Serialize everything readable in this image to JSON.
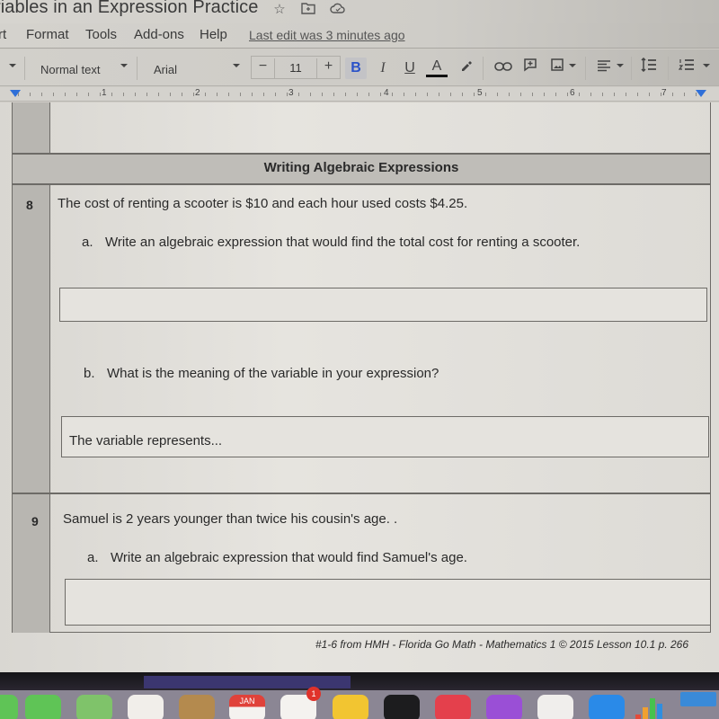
{
  "app": {
    "doc_title": "riables in an Expression Practice",
    "title_icons": [
      "star-icon",
      "move-to-folder-icon",
      "cloud-status-icon"
    ]
  },
  "menu": {
    "items": [
      "rt",
      "Format",
      "Tools",
      "Add-ons",
      "Help"
    ],
    "last_edit": "Last edit was 3 minutes ago"
  },
  "toolbar": {
    "style_select": "Normal text",
    "font_select": "Arial",
    "font_size": "11",
    "minus_label": "−",
    "plus_label": "+",
    "bold_label": "B",
    "italic_label": "I",
    "underline_label": "U",
    "text_color_label": "A",
    "icons": [
      "highlight-icon",
      "link-icon",
      "comment-icon",
      "image-icon",
      "align-icon",
      "line-spacing-icon",
      "numbered-list-icon"
    ]
  },
  "ruler": {
    "numbers": [
      "1",
      "2",
      "3",
      "4",
      "5",
      "6",
      "7"
    ]
  },
  "document": {
    "section_title": "Writing Algebraic Expressions",
    "questions": [
      {
        "number": "8",
        "text": "The cost of renting a scooter is $10 and each hour used costs $4.25.",
        "parts": [
          {
            "label": "a.",
            "text": "Write an algebraic expression that would find the total cost for renting a scooter.",
            "answer": ""
          },
          {
            "label": "b.",
            "text": "What is the meaning of the variable in your expression?",
            "answer": "The variable represents..."
          }
        ]
      },
      {
        "number": "9",
        "text": "Samuel is 2 years younger than twice his cousin's age. .",
        "parts": [
          {
            "label": "a.",
            "text": "Write an algebraic expression that would find Samuel's age.",
            "answer": ""
          }
        ]
      }
    ],
    "footer_note": "#1-6 from HMH - Florida Go Math - Mathematics 1 © 2015  Lesson 10.1 p. 266"
  },
  "dock": {
    "calendar_month": "JAN",
    "reminders_badge": "1",
    "colors": {
      "messages": "#5fc456",
      "maps": "#7fc36a",
      "photos": "#f1eeea",
      "contacts": "#b48a4e",
      "calendar": "#f4f2ef",
      "reminders": "#f4f2ef",
      "notes": "#f2c531",
      "tv": "#1c1c1e",
      "music": "#e4404c",
      "podcasts": "#9a4fd6",
      "news": "#f0eeec",
      "appstore": "#2a8ae8",
      "numbers": "#8b8694",
      "keynote": "#3a8ad8"
    }
  }
}
